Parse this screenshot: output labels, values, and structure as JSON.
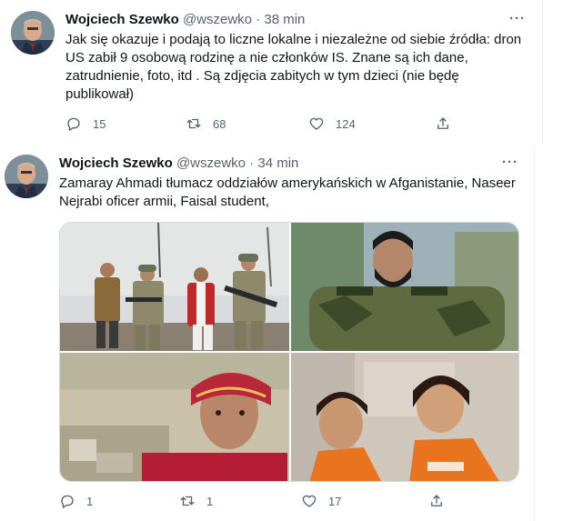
{
  "tweets": [
    {
      "author_name": "Wojciech Szewko",
      "handle": "@wszewko",
      "separator": "·",
      "time": "38 min",
      "more_label": "···",
      "text": "Jak się okazuje i podają to liczne lokalne i niezależne od siebie źródła: dron US zabił 9 osobową rodzinę a nie członków IS. Znane są ich dane, zatrudnienie, foto, itd . Są zdjęcia zabitych w tym dzieci (nie będę publikował)",
      "replies": "15",
      "retweets": "68",
      "likes": "124"
    },
    {
      "author_name": "Wojciech Szewko",
      "handle": "@wszewko",
      "separator": "·",
      "time": "34 min",
      "more_label": "···",
      "text": "Zamaray Ahmadi tłumacz oddziałów amerykańskich w Afganistanie, Naseer Nejrabi oficer armii, Faisal student,",
      "replies": "1",
      "retweets": "1",
      "likes": "17"
    }
  ],
  "icons": {
    "reply": "reply-icon",
    "retweet": "retweet-icon",
    "like": "heart-icon",
    "share": "share-icon",
    "more": "more-icon"
  },
  "colors": {
    "text_primary": "#0f1419",
    "text_secondary": "#536471",
    "border": "#cfd9de"
  }
}
